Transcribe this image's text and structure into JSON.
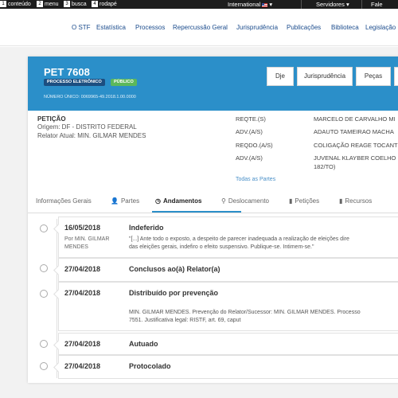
{
  "access_bar": {
    "items": [
      {
        "num": "1",
        "label": "conteúdo"
      },
      {
        "num": "2",
        "label": "menu"
      },
      {
        "num": "3",
        "label": "busca"
      },
      {
        "num": "4",
        "label": "rodapé"
      }
    ],
    "international": "International",
    "servidores": "Servidores",
    "fale": "Fale conos"
  },
  "nav": {
    "items": [
      "O STF",
      "Estatística",
      "Processos",
      "Repercussão Geral",
      "Jurisprudência",
      "Publicações",
      "Biblioteca",
      "Legislação"
    ]
  },
  "process": {
    "title": "PET 7608",
    "badge_eletronico": "PROCESSO ELETRÔNICO",
    "badge_publico": "PÚBLICO",
    "numero_unico": "NÚMERO ÚNICO: 0069965-49.2018.1.00.0000",
    "buttons": [
      "Dje",
      "Jurisprudência",
      "Peças"
    ]
  },
  "info": {
    "classe": "PETIÇÃO",
    "origem": "Origem: DF - DISTRITO FEDERAL",
    "relator": "Relator Atual: MIN. GILMAR MENDES"
  },
  "parties": {
    "rows": [
      {
        "role": "REQTE.(S)",
        "name": "MARCELO DE CARVALHO MI"
      },
      {
        "role": "ADV.(A/S)",
        "name": "ADAUTO TAMEIRAO MACHA"
      },
      {
        "role": "REQDO.(A/S)",
        "name": "COLIGAÇÃO REAGE TOCANT"
      },
      {
        "role": "ADV.(A/S)",
        "name": "JUVENAL KLAYBER COELHO"
      },
      {
        "role": "",
        "name": "182/TO)"
      }
    ],
    "todas": "Todas as Partes"
  },
  "tabs": {
    "items": [
      {
        "label": "Informações Gerais",
        "icon": ""
      },
      {
        "label": "Partes",
        "icon": "person-icon"
      },
      {
        "label": "Andamentos",
        "icon": "clock-icon"
      },
      {
        "label": "Deslocamento",
        "icon": "map-pin-icon"
      },
      {
        "label": "Petições",
        "icon": "document-icon"
      },
      {
        "label": "Recursos",
        "icon": "document-icon"
      }
    ]
  },
  "andamentos": [
    {
      "date": "16/05/2018",
      "by": "Por MIN. GILMAR MENDES",
      "title": "Indeferido",
      "desc1": "\"[...] Ante todo o exposto, a despeito de parecer inadequada a realização de eleições dire",
      "desc2": "das eleições gerais, indefiro o efeito suspensivo. Publique-se. Intimem-se.\""
    },
    {
      "date": "27/04/2018",
      "title": "Conclusos ao(à) Relator(a)"
    },
    {
      "date": "27/04/2018",
      "title": "Distribuído por prevenção",
      "desc1": "MIN. GILMAR MENDES. Prevenção do Relator/Sucessor: MIN. GILMAR MENDES. Processo",
      "desc2": "7551. Justificativa legal: RISTF, art. 69, caput"
    },
    {
      "date": "27/04/2018",
      "title": "Autuado"
    },
    {
      "date": "27/04/2018",
      "title": "Protocolado"
    }
  ]
}
